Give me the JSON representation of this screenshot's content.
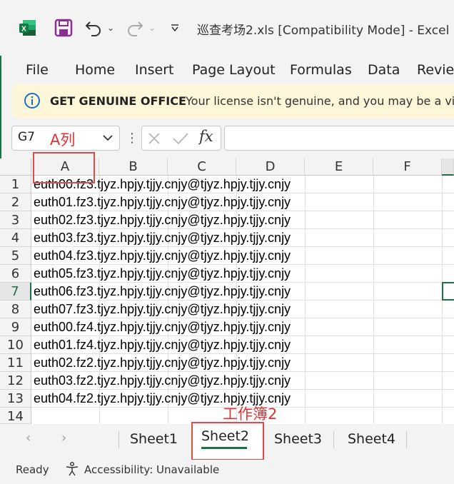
{
  "window": {
    "title": "巡查考场2.xls  [Compatibility Mode]  -  Excel"
  },
  "ribbon": {
    "tabs": [
      "File",
      "Home",
      "Insert",
      "Page Layout",
      "Formulas",
      "Data",
      "Review"
    ]
  },
  "banner": {
    "title": "GET GENUINE OFFICE",
    "message": "Your license isn't genuine, and you may be a vic"
  },
  "formula_bar": {
    "name_box": "G7",
    "fx_label": "fx",
    "value": ""
  },
  "grid": {
    "columns": [
      "A",
      "B",
      "C",
      "D",
      "E",
      "F"
    ],
    "rows": [
      "1",
      "2",
      "3",
      "4",
      "5",
      "6",
      "7",
      "8",
      "9",
      "10",
      "11",
      "12",
      "13",
      "14"
    ],
    "active_cell": "G7",
    "cells_A": [
      "euth00.fz3.tjyz.hpjy.tjjy.cnjy@tjyz.hpjy.tjjy.cnjy",
      "euth01.fz3.tjyz.hpjy.tjjy.cnjy@tjyz.hpjy.tjjy.cnjy",
      "euth02.fz3.tjyz.hpjy.tjjy.cnjy@tjyz.hpjy.tjjy.cnjy",
      "euth03.fz3.tjyz.hpjy.tjjy.cnjy@tjyz.hpjy.tjjy.cnjy",
      "euth04.fz3.tjyz.hpjy.tjjy.cnjy@tjyz.hpjy.tjjy.cnjy",
      "euth05.fz3.tjyz.hpjy.tjjy.cnjy@tjyz.hpjy.tjjy.cnjy",
      "euth06.fz3.tjyz.hpjy.tjjy.cnjy@tjyz.hpjy.tjjy.cnjy",
      "euth07.fz3.tjyz.hpjy.tjjy.cnjy@tjyz.hpjy.tjjy.cnjy",
      "euth00.fz4.tjyz.hpjy.tjjy.cnjy@tjyz.hpjy.tjjy.cnjy",
      "euth01.fz4.tjyz.hpjy.tjjy.cnjy@tjyz.hpjy.tjjy.cnjy",
      "euth02.fz2.tjyz.hpjy.tjjy.cnjy@tjyz.hpjy.tjjy.cnjy",
      "euth03.fz2.tjyz.hpjy.tjjy.cnjy@tjyz.hpjy.tjjy.cnjy",
      "euth04.fz2.tjyz.hpjy.tjjy.cnjy@tjyz.hpjy.tjjy.cnjy"
    ]
  },
  "sheet_tabs": {
    "tabs": [
      "Sheet1",
      "Sheet2",
      "Sheet3",
      "Sheet4"
    ],
    "active": "Sheet2"
  },
  "annotations": {
    "column_a_label": "A列",
    "sheet_label": "工作簿2"
  },
  "status": {
    "ready": "Ready",
    "accessibility": "Accessibility: Unavailable"
  },
  "colors": {
    "excel_green": "#1e7145",
    "annotation_red": "#e24b4b",
    "banner_bg": "#fdf6d8",
    "undo_purple": "#7a2a8a"
  },
  "icons": [
    "excel-logo-icon",
    "save-icon",
    "undo-icon",
    "redo-icon",
    "customize-qat-icon",
    "info-icon",
    "cancel-icon",
    "enter-icon",
    "accessibility-icon"
  ]
}
